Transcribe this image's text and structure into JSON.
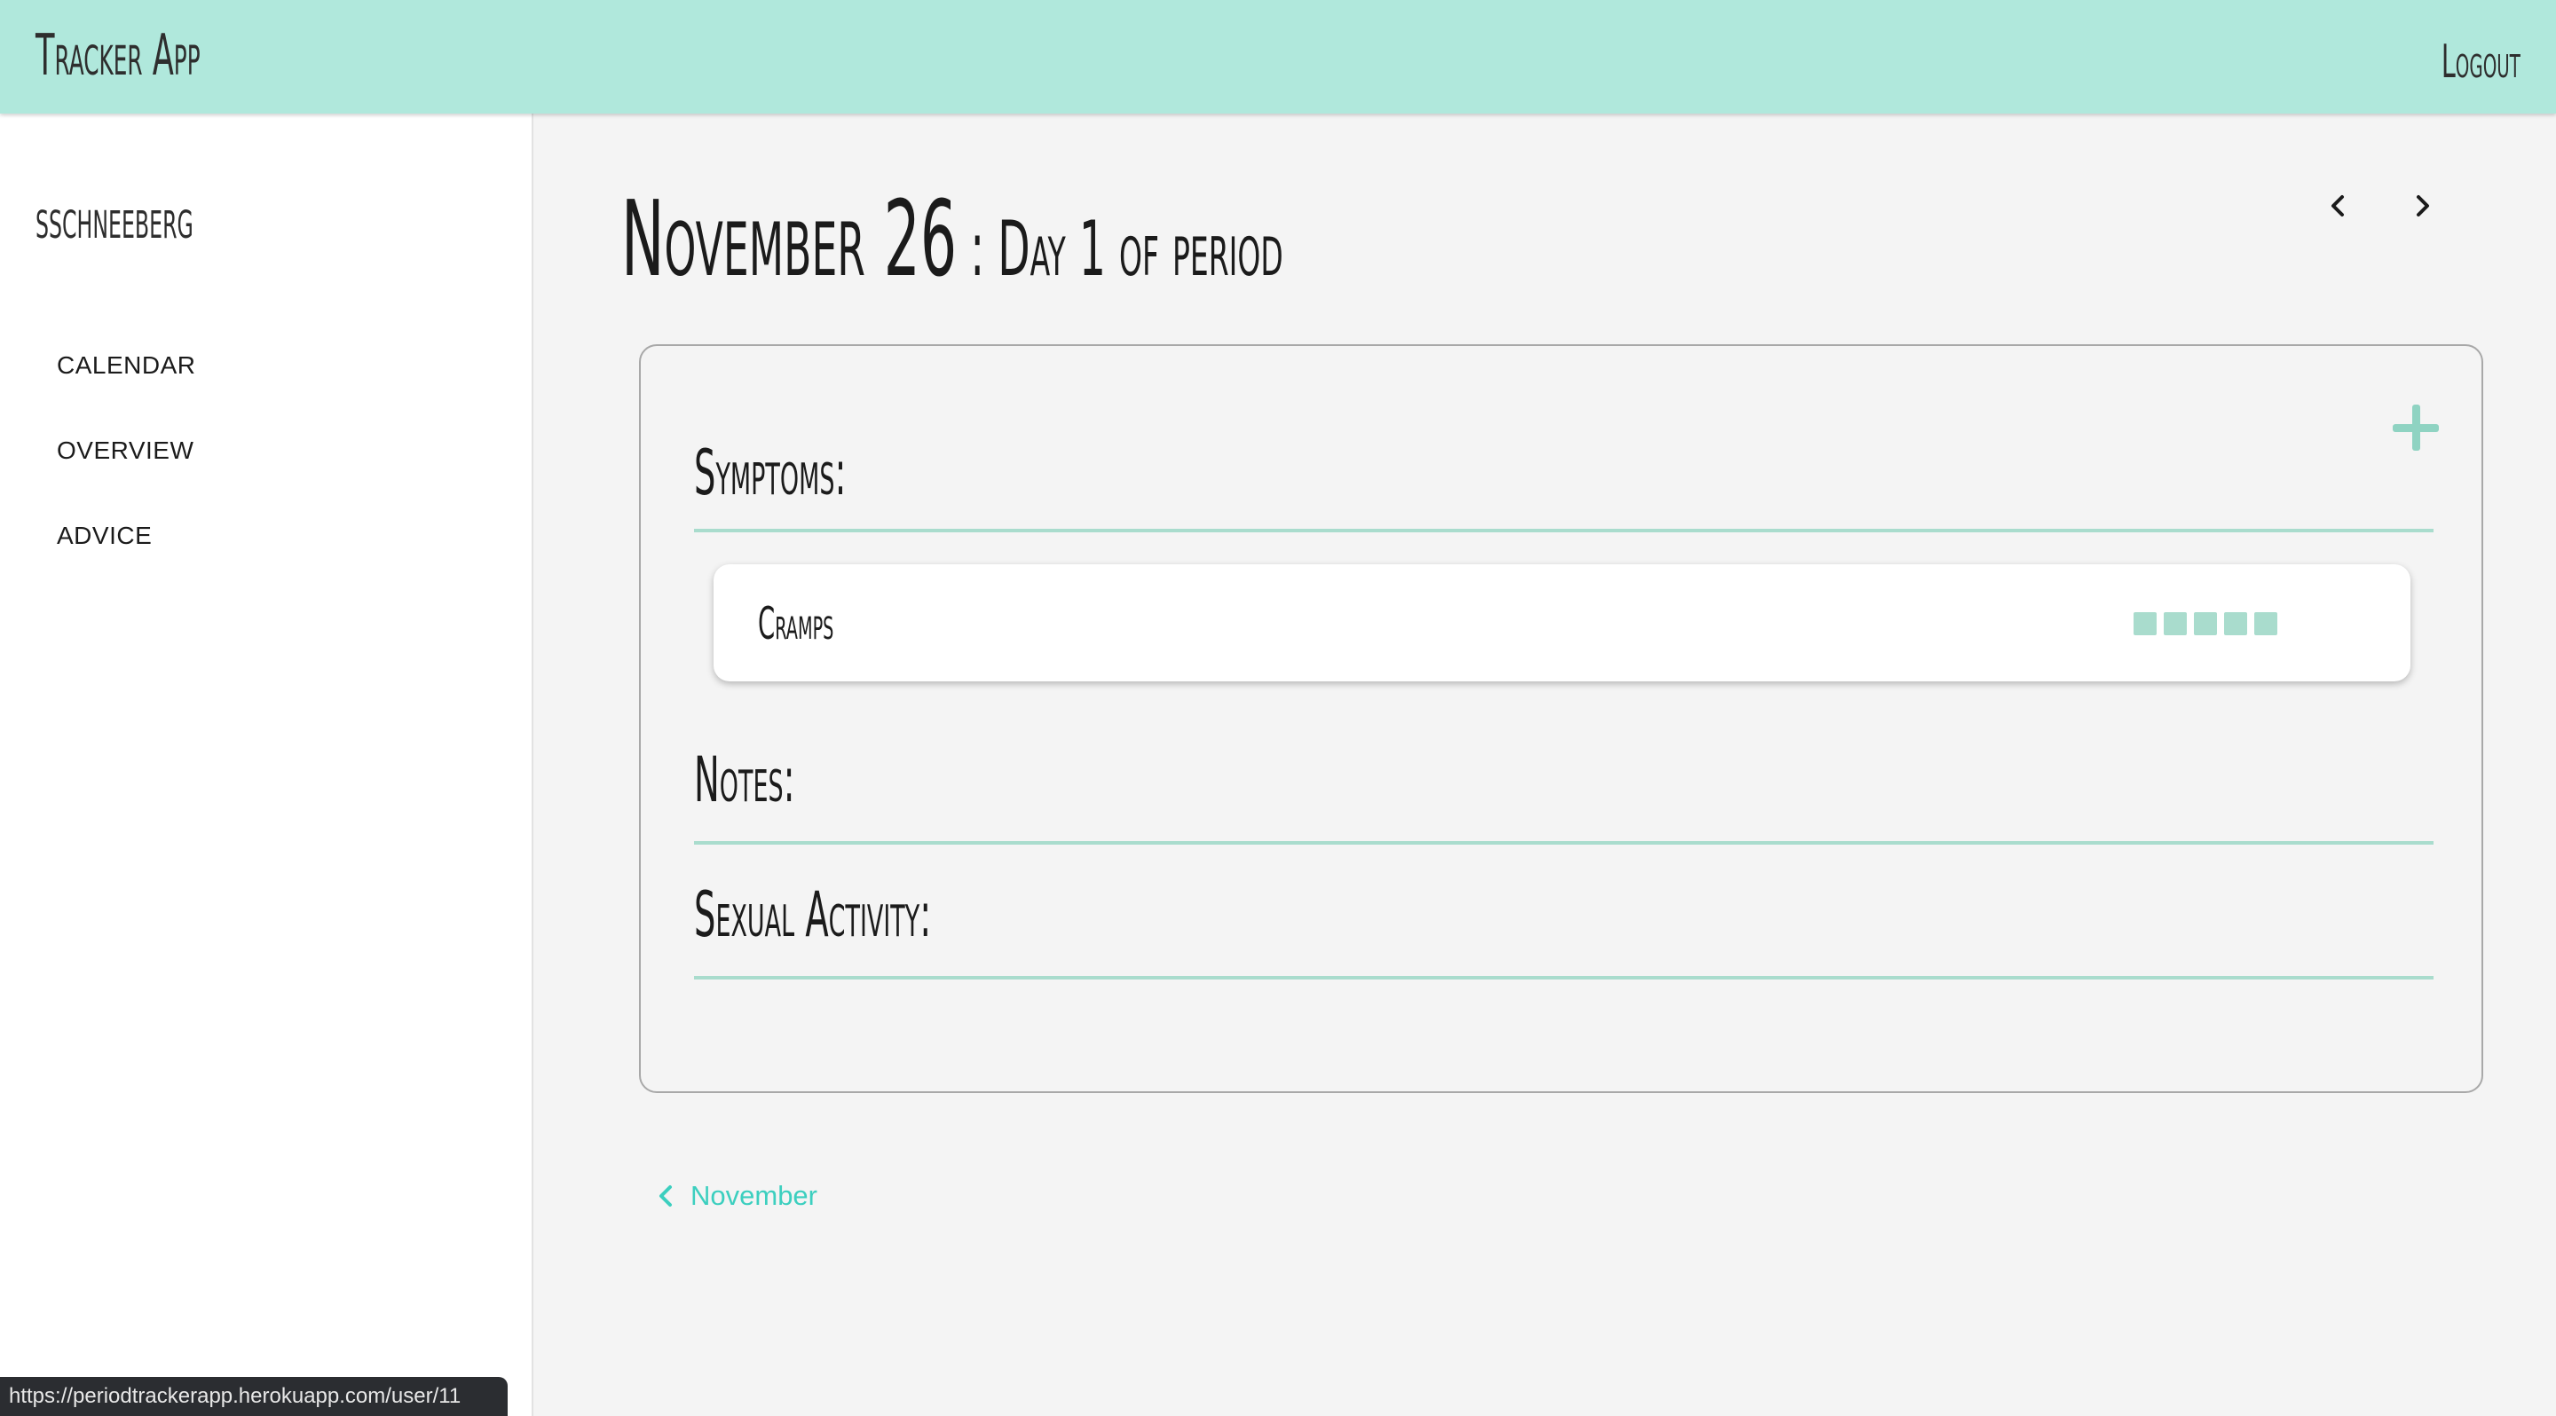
{
  "header": {
    "app_title": "Tracker App",
    "logout_label": "Logout"
  },
  "sidebar": {
    "username": "sschneeberg",
    "items": [
      {
        "label": "CALENDAR"
      },
      {
        "label": "OVERVIEW"
      },
      {
        "label": "ADVICE"
      }
    ]
  },
  "main": {
    "date": "November 26",
    "separator": " : ",
    "day_info": "Day 1 of period",
    "sections": {
      "symptoms": "Symptoms:",
      "notes": "Notes:",
      "sexual_activity": "Sexual Activity:"
    },
    "symptoms": [
      {
        "name": "Cramps",
        "severity": 5,
        "severity_max": 5
      }
    ],
    "back_link": "November"
  },
  "status_bar": {
    "url": "https://periodtrackerapp.herokuapp.com/user/11"
  },
  "colors": {
    "header_bg": "#b0e8dc",
    "accent": "#a9dccd",
    "link": "#3ccfbf"
  },
  "icons": {
    "prev": "chevron-left-icon",
    "next": "chevron-right-icon",
    "add": "plus-icon",
    "back": "chevron-left-icon"
  }
}
